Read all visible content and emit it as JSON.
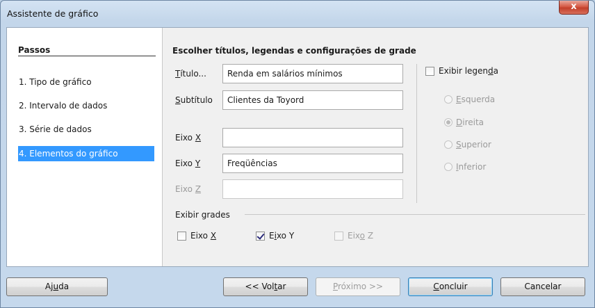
{
  "window": {
    "title": "Assistente de gráfico",
    "close_glyph": "x"
  },
  "steps": {
    "title": "Passos",
    "items": [
      {
        "label": "1. Tipo de gráfico",
        "active": false
      },
      {
        "label": "2. Intervalo de dados",
        "active": false
      },
      {
        "label": "3. Série de dados",
        "active": false
      },
      {
        "label": "4. Elementos do gráfico",
        "active": true
      }
    ]
  },
  "panel": {
    "heading": "Escolher títulos, legendas e configurações de grade",
    "fields": {
      "title": {
        "label_pre": "",
        "label_key": "T",
        "label_post": "ítulo...",
        "value": "Renda em salários mínimos"
      },
      "subtitle": {
        "label_pre": "",
        "label_key": "S",
        "label_post": "ubtítulo",
        "value": "Clientes da Toyord"
      },
      "x_axis": {
        "label_pre": "Eixo ",
        "label_key": "X",
        "label_post": "",
        "value": ""
      },
      "y_axis": {
        "label_pre": "Eixo ",
        "label_key": "Y",
        "label_post": "",
        "value": "Freqüências"
      },
      "z_axis": {
        "label_pre": "Eixo ",
        "label_key": "Z",
        "label_post": "",
        "value": "",
        "disabled": true
      }
    },
    "legend": {
      "show_label_pre": "Exibir legen",
      "show_label_key": "d",
      "show_label_post": "a",
      "show_checked": false,
      "positions": [
        {
          "key": "E",
          "rest": "squerda",
          "selected": false
        },
        {
          "key": "D",
          "rest": "ireita",
          "selected": true
        },
        {
          "key": "S",
          "rest": "uperior",
          "selected": false
        },
        {
          "key": "I",
          "rest": "nferior",
          "selected": false
        }
      ]
    },
    "grids": {
      "title": "Exibir grades",
      "x": {
        "pre": "Eixo ",
        "key": "X",
        "post": "",
        "checked": false
      },
      "y": {
        "pre": "E",
        "key": "i",
        "post": "xo Y",
        "checked": true
      },
      "z": {
        "pre": "Eix",
        "key": "o",
        "post": " Z",
        "checked": false,
        "disabled": true
      }
    }
  },
  "buttons": {
    "help": {
      "pre": "Aj",
      "key": "u",
      "post": "da"
    },
    "back": {
      "pre": "<< Vol",
      "key": "t",
      "post": "ar"
    },
    "next": {
      "pre": "",
      "key": "P",
      "post": "róximo >>"
    },
    "finish": {
      "pre": "",
      "key": "C",
      "post": "oncluir"
    },
    "cancel": {
      "label": "Cancelar"
    }
  }
}
